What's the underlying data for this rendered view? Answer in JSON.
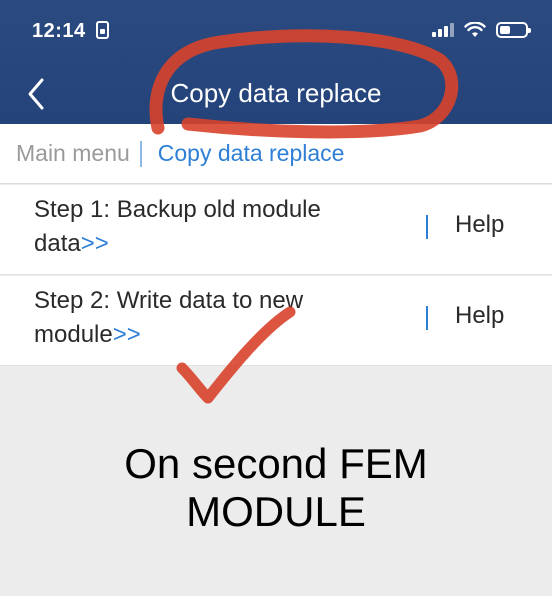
{
  "status_bar": {
    "time": "12:14",
    "icons": [
      "lock-icon",
      "signal-icon",
      "wifi-icon",
      "battery-icon"
    ]
  },
  "nav": {
    "back_icon": "chevron-left-icon",
    "title": "Copy data replace"
  },
  "breadcrumb": {
    "home": "Main menu",
    "current": "Copy data replace"
  },
  "steps": [
    {
      "line1": "Step 1: Backup old module",
      "line2": "data",
      "arrow": ">>",
      "help": "Help"
    },
    {
      "line1": "Step 2: Write data to new",
      "line2": "module",
      "arrow": ">>",
      "help": "Help"
    }
  ],
  "caption": {
    "line1": "On second FEM",
    "line2": "MODULE"
  },
  "colors": {
    "header": "#23437a",
    "link": "#2e7fd6",
    "annotation": "#d8432b"
  }
}
